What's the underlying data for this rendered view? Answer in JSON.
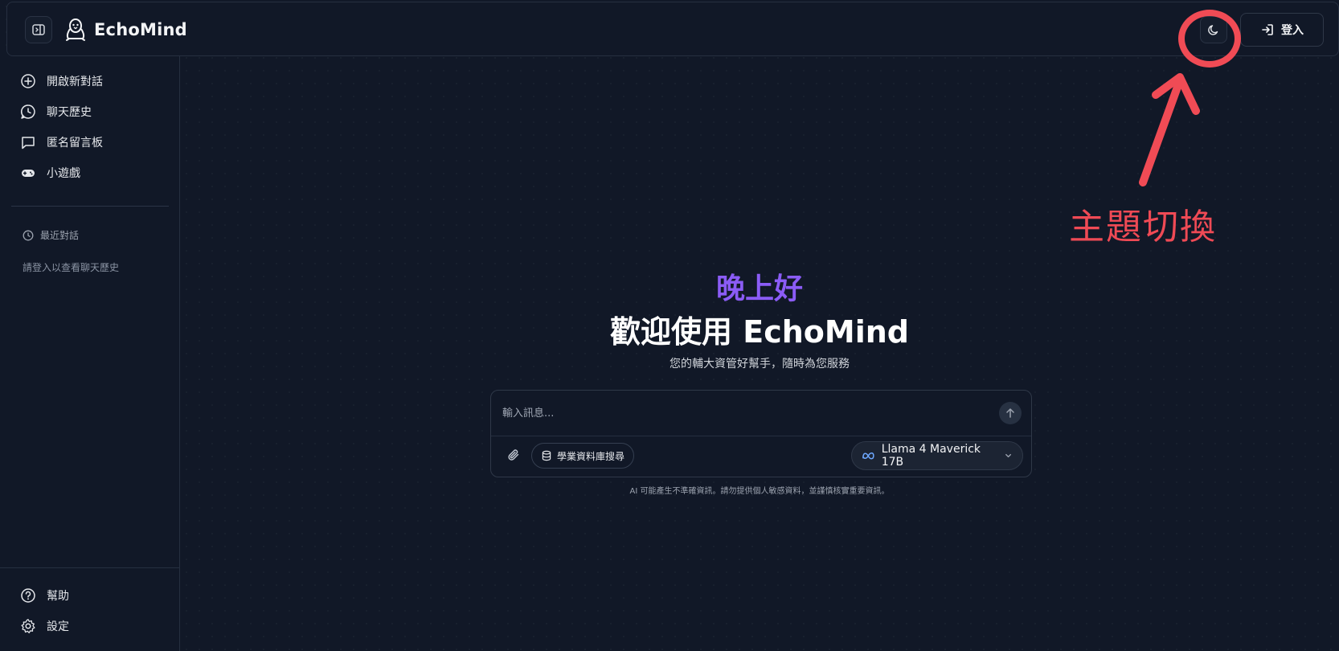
{
  "header": {
    "app_name": "EchoMind",
    "login_label": "登入"
  },
  "sidebar": {
    "nav_items": [
      {
        "label": "開啟新對話",
        "icon": "plus-circle-icon"
      },
      {
        "label": "聊天歷史",
        "icon": "chat-history-icon"
      },
      {
        "label": "匿名留言板",
        "icon": "message-square-icon"
      },
      {
        "label": "小遊戲",
        "icon": "gamepad-icon"
      }
    ],
    "recent_header": "最近對話",
    "recent_empty": "請登入以查看聊天歷史",
    "bottom_items": [
      {
        "label": "幫助",
        "icon": "help-circle-icon"
      },
      {
        "label": "設定",
        "icon": "gear-icon"
      }
    ]
  },
  "main": {
    "greeting": "晚上好",
    "welcome": "歡迎使用 EchoMind",
    "subtitle": "您的輔大資管好幫手，隨時為您服務",
    "composer": {
      "placeholder": "輸入訊息...",
      "db_search_label": "學業資料庫搜尋",
      "model_label": "Llama 4 Maverick 17B"
    },
    "disclaimer": "AI 可能產生不準確資訊。請勿提供個人敏感資料，並謹慎核實重要資訊。"
  },
  "annotation": {
    "label": "主題切換",
    "color": "#ef4a55"
  },
  "colors": {
    "background": "#111827",
    "accent_purple": "#8b5cf6",
    "border": "#262f40"
  }
}
